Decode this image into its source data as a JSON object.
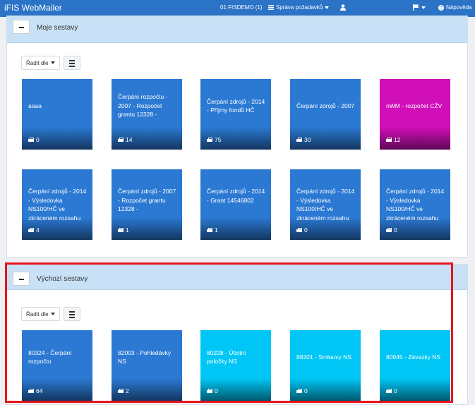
{
  "navbar": {
    "brand": "iFIS WebMailer",
    "org": "01 FISDEMO (1)",
    "requests_menu": "Správa požadavků",
    "help": "Nápověda",
    "colors": {
      "bar": "#2a73c7"
    }
  },
  "panels": [
    {
      "title": "Moje sestavy",
      "sort_label": "Řadit dle",
      "tiles": [
        {
          "label": "aaaa",
          "count": "0",
          "color": "#2b79d3"
        },
        {
          "label": "Čerpání rozpočtu - 2007 - Rozpočet grantu 12328 -",
          "count": "14",
          "color": "#2b79d3"
        },
        {
          "label": "Čerpání zdrojů - 2014 - Příjmy fondů HČ",
          "count": "75",
          "color": "#2b79d3"
        },
        {
          "label": "Čerpání zdrojů - 2007",
          "count": "30",
          "color": "#2b79d3"
        },
        {
          "label": "nWM - rozpočet CŽV",
          "count": "12",
          "color": "#d10fb9"
        },
        {
          "label": "Čerpání zdrojů - 2014 - Výsledovka NS100/HČ ve zkráceném rozsahu",
          "count": "4",
          "color": "#2b79d3"
        },
        {
          "label": "Čerpání zdrojů - 2007 - Rozpočet grantu 12328 -",
          "count": "1",
          "color": "#2b79d3"
        },
        {
          "label": "Čerpání zdrojů - 2014 - Grant 14546802",
          "count": "1",
          "color": "#2b79d3"
        },
        {
          "label": "Čerpání zdrojů - 2014 - Výsledovka NS100/HČ ve zkráceném rozsahu",
          "count": "0",
          "color": "#2b79d3"
        },
        {
          "label": "Čerpání zdrojů - 2014 - Výsledovka NS100/HČ ve zkráceném rozsahu",
          "count": "0",
          "color": "#2b79d3"
        }
      ]
    },
    {
      "title": "Výchozí sestavy",
      "sort_label": "Řadit dle",
      "tiles": [
        {
          "label": "80324 - Čerpání rozpočtu",
          "count": "64",
          "color": "#2b79d3"
        },
        {
          "label": "82003 - Pohledávky NS",
          "count": "2",
          "color": "#2b79d3"
        },
        {
          "label": "80228 - Účetní položky NS",
          "count": "0",
          "color": "#00c6f5"
        },
        {
          "label": "88201 - Smlouvy NS",
          "count": "0",
          "color": "#00c6f5"
        },
        {
          "label": "80045 - Závazky NS",
          "count": "0",
          "color": "#00c6f5"
        }
      ]
    }
  ],
  "icons": [
    "list-icon",
    "user-icon",
    "flag-icon",
    "question-icon",
    "printer-icon",
    "minus-icon",
    "caret-down-icon"
  ]
}
